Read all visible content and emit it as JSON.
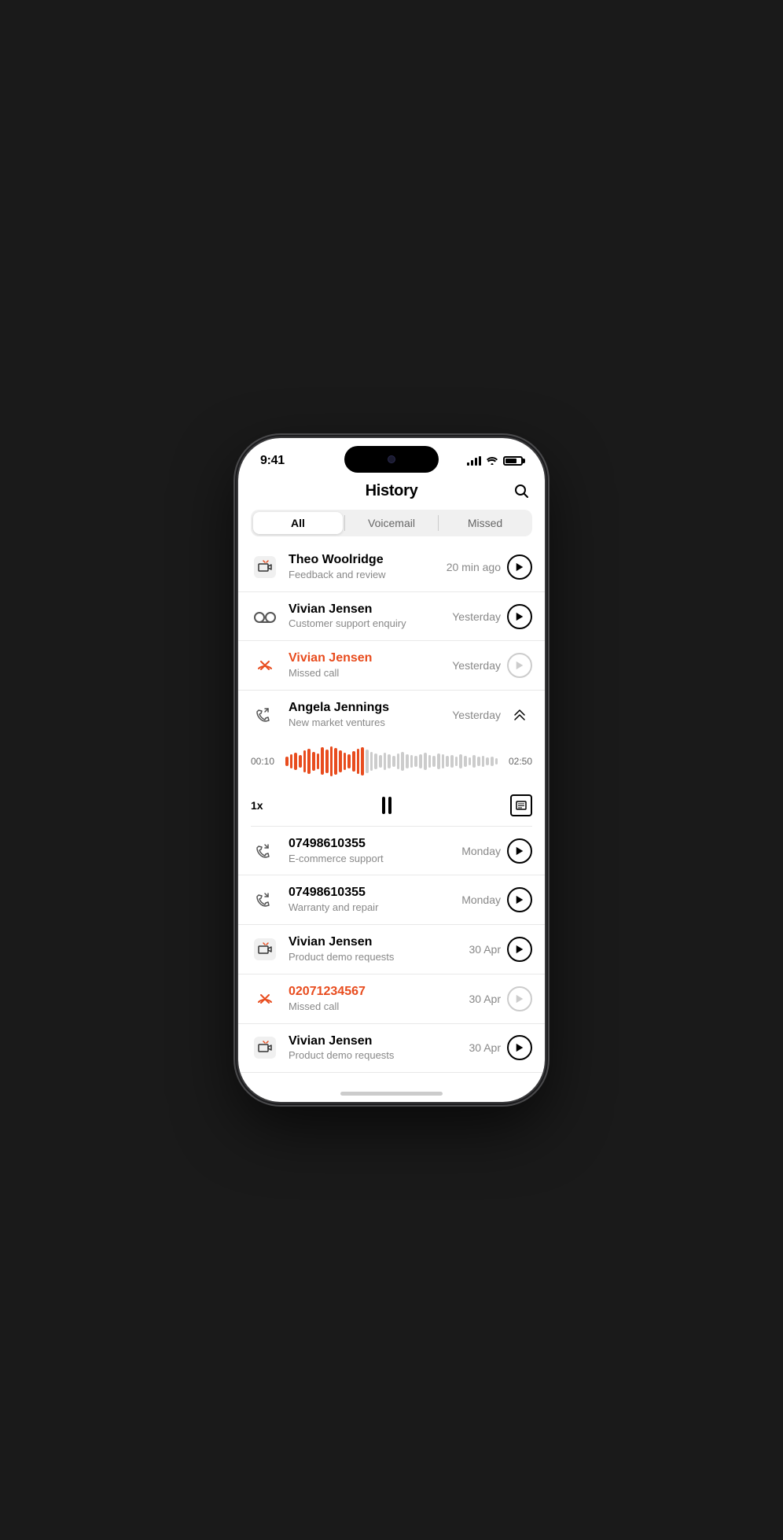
{
  "status_bar": {
    "time": "9:41",
    "signal_bars": [
      4,
      6,
      9,
      12
    ],
    "wifi": "wifi",
    "battery": 75
  },
  "header": {
    "title": "History",
    "search_icon": "search"
  },
  "filter_tabs": [
    {
      "label": "All",
      "active": true
    },
    {
      "label": "Voicemail",
      "active": false
    },
    {
      "label": "Missed",
      "active": false
    }
  ],
  "calls": [
    {
      "id": 1,
      "type": "video",
      "name": "Theo Woolridge",
      "subtitle": "Feedback and review",
      "time": "20 min ago",
      "missed": false,
      "has_recording": true,
      "expanded": false
    },
    {
      "id": 2,
      "type": "voicemail",
      "name": "Vivian Jensen",
      "subtitle": "Customer support enquiry",
      "time": "Yesterday",
      "missed": false,
      "has_recording": true,
      "expanded": false
    },
    {
      "id": 3,
      "type": "missed",
      "name": "Vivian Jensen",
      "subtitle": "Missed call",
      "time": "Yesterday",
      "missed": true,
      "has_recording": false,
      "expanded": false
    },
    {
      "id": 4,
      "type": "incoming",
      "name": "Angela Jennings",
      "subtitle": "New market ventures",
      "time": "Yesterday",
      "missed": false,
      "has_recording": true,
      "expanded": true,
      "playback_current": "00:10",
      "playback_total": "02:50",
      "playback_progress": 0.38,
      "speed": "1x"
    },
    {
      "id": 5,
      "type": "incoming",
      "name": "07498610355",
      "subtitle": "E-commerce support",
      "time": "Monday",
      "missed": false,
      "has_recording": true,
      "expanded": false
    },
    {
      "id": 6,
      "type": "incoming",
      "name": "07498610355",
      "subtitle": "Warranty and repair",
      "time": "Monday",
      "missed": false,
      "has_recording": true,
      "expanded": false
    },
    {
      "id": 7,
      "type": "video",
      "name": "Vivian Jensen",
      "subtitle": "Product demo requests",
      "time": "30 Apr",
      "missed": false,
      "has_recording": true,
      "expanded": false
    },
    {
      "id": 8,
      "type": "missed",
      "name": "02071234567",
      "subtitle": "Missed call",
      "time": "30 Apr",
      "missed": true,
      "has_recording": false,
      "expanded": false
    },
    {
      "id": 9,
      "type": "video",
      "name": "Vivian Jensen",
      "subtitle": "Product demo requests",
      "time": "30 Apr",
      "missed": false,
      "has_recording": true,
      "expanded": false
    }
  ],
  "waveform": {
    "played_bars": 18,
    "total_bars": 48
  }
}
